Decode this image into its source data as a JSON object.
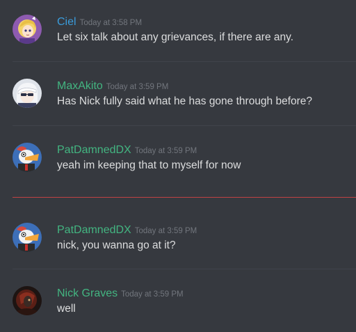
{
  "messages": [
    {
      "author": "Ciel",
      "author_color": "#3a9cdb",
      "timestamp": "Today at 3:58 PM",
      "content": "Let six talk about any grievances, if there are any.",
      "avatar": "anime-blonde-girl-avatar"
    },
    {
      "author": "MaxAkito",
      "author_color": "#43b581",
      "timestamp": "Today at 3:59 PM",
      "content": "Has Nick fully said what he has gone through before?",
      "avatar": "white-hair-sunglasses-avatar"
    },
    {
      "author": "PatDamnedDX",
      "author_color": "#43b581",
      "timestamp": "Today at 3:59 PM",
      "content": "yeah im keeping that to myself for now",
      "avatar": "cartoon-duck-avatar"
    },
    {
      "author": "PatDamnedDX",
      "author_color": "#43b581",
      "timestamp": "Today at 3:59 PM",
      "content": "nick, you wanna go at it?",
      "avatar": "cartoon-duck-avatar"
    },
    {
      "author": "Nick Graves",
      "author_color": "#43b581",
      "timestamp": "Today at 3:59 PM",
      "content": "well",
      "avatar": "dark-red-figure-avatar"
    }
  ],
  "colors": {
    "background": "#36393f",
    "text": "#dcddde",
    "timestamp": "#72767d",
    "divider": "#40444b",
    "new_messages_divider": "#f04747"
  }
}
